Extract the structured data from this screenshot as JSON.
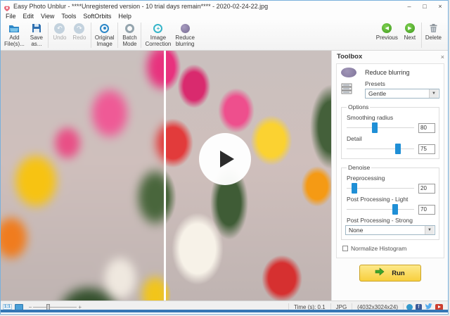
{
  "window": {
    "title": "Easy Photo Unblur - ****Unregistered version - 10 trial days remain**** - 2020-02-24-22.jpg",
    "controls": {
      "minimize": "–",
      "maximize": "□",
      "close": "×"
    }
  },
  "menu": {
    "items": [
      "File",
      "Edit",
      "View",
      "Tools",
      "SoftOrbits",
      "Help"
    ]
  },
  "toolbar": {
    "left": [
      {
        "line1": "Add",
        "line2": "File(s)..."
      },
      {
        "line1": "Save",
        "line2": "as..."
      },
      {
        "line1": "Undo",
        "line2": ""
      },
      {
        "line1": "Redo",
        "line2": ""
      },
      {
        "line1": "Original",
        "line2": "Image"
      },
      {
        "line1": "Batch",
        "line2": "Mode"
      },
      {
        "line1": "Image",
        "line2": "Correction"
      },
      {
        "line1": "Reduce",
        "line2": "blurring"
      }
    ],
    "right": [
      {
        "label": "Previous"
      },
      {
        "label": "Next"
      },
      {
        "label": "Delete"
      }
    ]
  },
  "toolbox": {
    "header": "Toolbox",
    "close": "×",
    "tool_title": "Reduce blurring",
    "presets_label": "Presets",
    "preset_value": "Gentle",
    "options_label": "Options",
    "smoothing": {
      "label": "Smoothing radius",
      "value": "80"
    },
    "detail": {
      "label": "Detail",
      "value": "75"
    },
    "denoise_label": "Denoise",
    "preprocessing": {
      "label": "Preprocessing",
      "value": "20"
    },
    "post_light": {
      "label": "Post Processing - Light",
      "value": "70"
    },
    "post_strong_label": "Post Processing - Strong",
    "post_strong_value": "None",
    "normalize_label": "Normalize Histogram",
    "run_label": "Run"
  },
  "statusbar": {
    "time": "Time (s): 0.1",
    "format": "JPG",
    "dimensions": "(4032x3024x24)"
  },
  "colors": {
    "slider_thumb": "#1f8fd6",
    "run_button_fill": "#f8cf3e",
    "run_button_border": "#c9a227",
    "nav_green": "#3f9a1f",
    "status_stripe": "#3576b5",
    "tool_icon_purple": "#80759c",
    "window_border": "#7ab1dc"
  }
}
